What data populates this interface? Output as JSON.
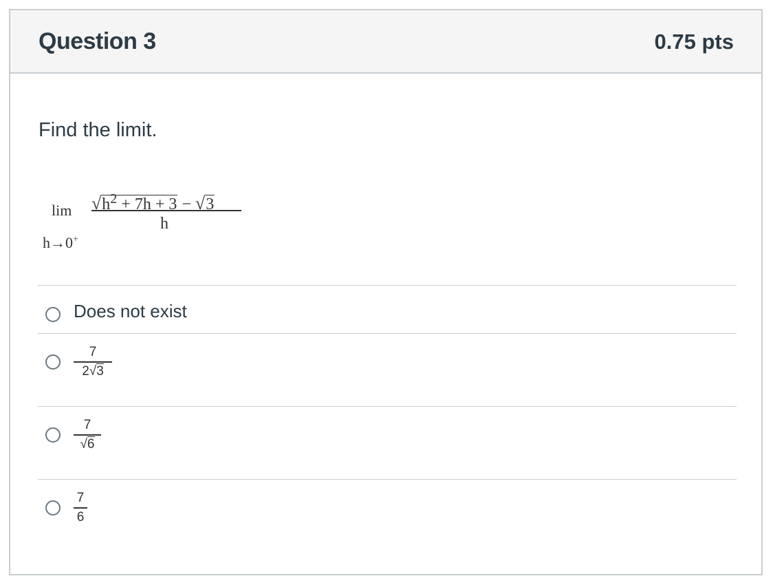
{
  "question": {
    "title": "Question 3",
    "points": "0.75 pts",
    "prompt": "Find the limit."
  },
  "math": {
    "lim_label": "lim",
    "lim_sub_var": "h",
    "lim_sub_arrow": "→",
    "lim_sub_target": "0",
    "lim_sub_sup": "+",
    "radical_symbol": "√",
    "numerator_radicand_1": "h",
    "numerator_radicand_1_exp": "2",
    "numerator_radicand_2": " + 7h + 3",
    "numerator_minus": " − ",
    "numerator_radicand_3": "3",
    "denominator": "h"
  },
  "answers": [
    {
      "label": "Does not exist"
    },
    {
      "numerator": "7",
      "denominator_coef": "2",
      "denominator_radicand": "3"
    },
    {
      "numerator": "7",
      "denominator_radicand": "6"
    },
    {
      "numerator": "7",
      "denominator": "6"
    }
  ]
}
